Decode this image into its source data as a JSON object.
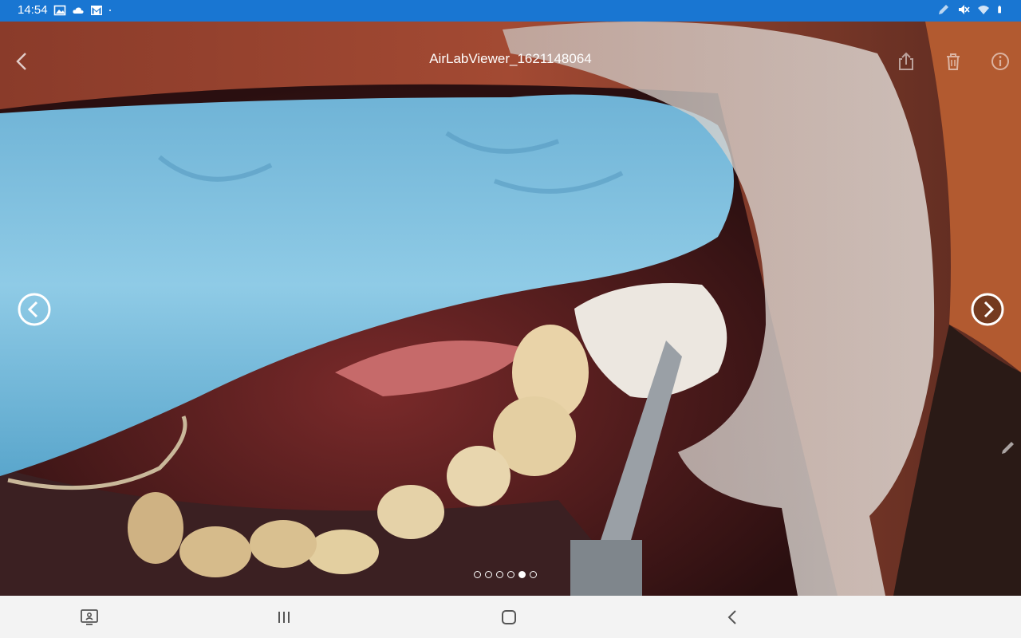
{
  "status_bar": {
    "time": "14:54",
    "icons_left": [
      "image-icon",
      "cloud-icon",
      "gmail-icon",
      "notification-dot-icon"
    ],
    "icons_right": [
      "pen-icon",
      "mute-icon",
      "wifi-icon",
      "battery-icon"
    ],
    "background_color": "#1976d2"
  },
  "viewer": {
    "title": "AirLabViewer_1621148064",
    "toolbar": [
      "share-icon",
      "delete-icon",
      "info-icon"
    ],
    "pager": {
      "count": 6,
      "active_index": 4
    }
  },
  "nav_bar": {
    "buttons": [
      "screenshot-icon",
      "recents-icon",
      "home-icon",
      "back-icon"
    ]
  }
}
